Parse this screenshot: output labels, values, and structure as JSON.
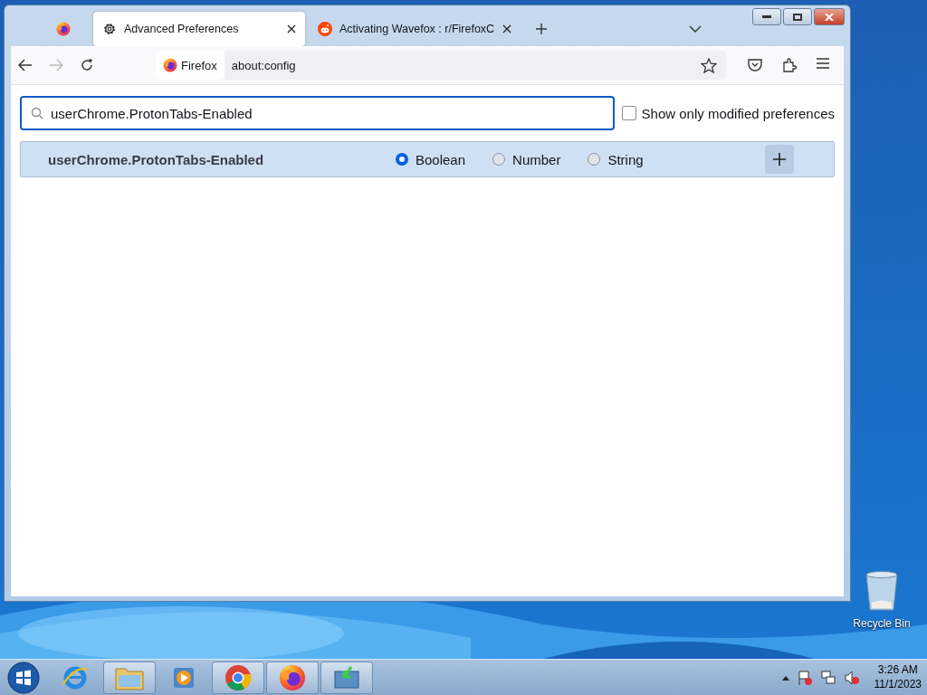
{
  "browser": {
    "tabs": [
      {
        "kind": "pinned",
        "selected": false
      },
      {
        "kind": "page",
        "title": "Advanced Preferences",
        "selected": true
      },
      {
        "kind": "page",
        "title": "Activating Wavefox : r/FirefoxC",
        "selected": false
      }
    ],
    "forward_disabled": true,
    "identity": "Firefox",
    "url": "about:config"
  },
  "config": {
    "search_value": "userChrome.ProtonTabs-Enabled",
    "modified_only": {
      "label": "Show only modified preferences",
      "checked": false
    },
    "new_pref": {
      "name": "userChrome.ProtonTabs-Enabled",
      "types": [
        {
          "label": "Boolean",
          "selected": true
        },
        {
          "label": "Number",
          "selected": false
        },
        {
          "label": "String",
          "selected": false
        }
      ]
    }
  },
  "desktop_icons": [
    {
      "label": "Recycle Bin"
    }
  ],
  "taskbar": {
    "apps": [
      {
        "kind": "ie",
        "running": false
      },
      {
        "kind": "explorer",
        "running": true
      },
      {
        "kind": "media",
        "running": false
      },
      {
        "kind": "chrome",
        "running": true
      },
      {
        "kind": "firefox",
        "running": true
      },
      {
        "kind": "transfer",
        "running": true
      }
    ],
    "time": "3:26 AM",
    "date": "11/1/2023"
  }
}
